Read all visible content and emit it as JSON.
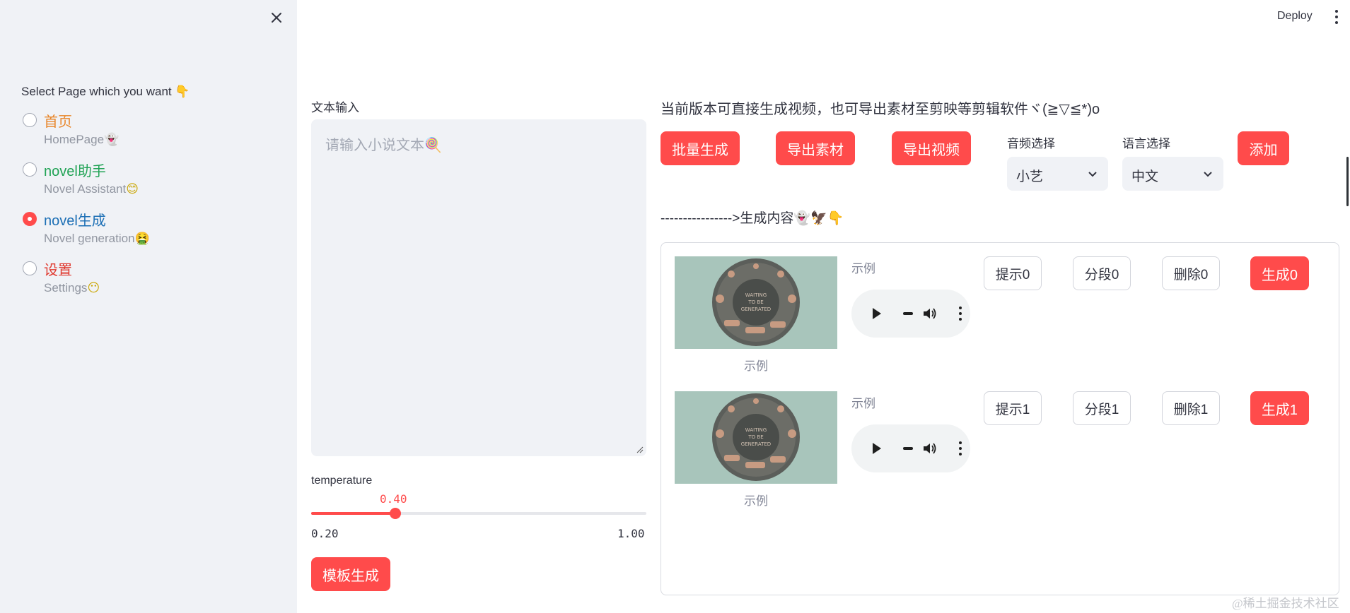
{
  "sidebar": {
    "label": "Select Page which you want",
    "label_emoji": "👇",
    "items": [
      {
        "title": "首页",
        "subtitle": "HomePage",
        "emoji": "👻",
        "title_color": "#e8862a",
        "checked": false
      },
      {
        "title": "novel助手",
        "subtitle": "Novel Assistant",
        "emoji": "😊",
        "title_color": "#21a355",
        "checked": false
      },
      {
        "title": "novel生成",
        "subtitle": "Novel generation",
        "emoji": "🤮",
        "title_color": "#1c6fb5",
        "checked": true
      },
      {
        "title": "设置",
        "subtitle": "Settings",
        "emoji": "😶",
        "title_color": "#e0392f",
        "checked": false
      }
    ]
  },
  "topbar": {
    "deploy": "Deploy"
  },
  "text_input": {
    "label": "文本输入",
    "placeholder": "请输入小说文本🍭"
  },
  "temperature": {
    "label": "temperature",
    "value": "0.40",
    "min": "0.20",
    "max": "1.00",
    "fraction": 0.25
  },
  "template_button": "模板生成",
  "info_text": "当前版本可直接生成视频，也可导出素材至剪映等剪辑软件ヾ(≧▽≦*)o",
  "toolbar": {
    "batch": "批量生成",
    "export_assets": "导出素材",
    "export_video": "导出视频",
    "audio_label": "音频选择",
    "audio_value": "小艺",
    "lang_label": "语言选择",
    "lang_value": "中文",
    "add": "添加"
  },
  "section_title": "---------------->生成内容👻🦅👇",
  "rows": [
    {
      "caption": "示例",
      "audio_label": "示例",
      "hint": "提示0",
      "segment": "分段0",
      "delete": "删除0",
      "generate": "生成0"
    },
    {
      "caption": "示例",
      "audio_label": "示例",
      "hint": "提示1",
      "segment": "分段1",
      "delete": "删除1",
      "generate": "生成1"
    }
  ],
  "thumbnail_text": [
    "WAITING",
    "TO BE",
    "GENERATED"
  ],
  "watermark": "@稀土掘金技术社区",
  "colors": {
    "accent": "#ff4b4b",
    "sidebar_bg": "#f0f2f6"
  }
}
